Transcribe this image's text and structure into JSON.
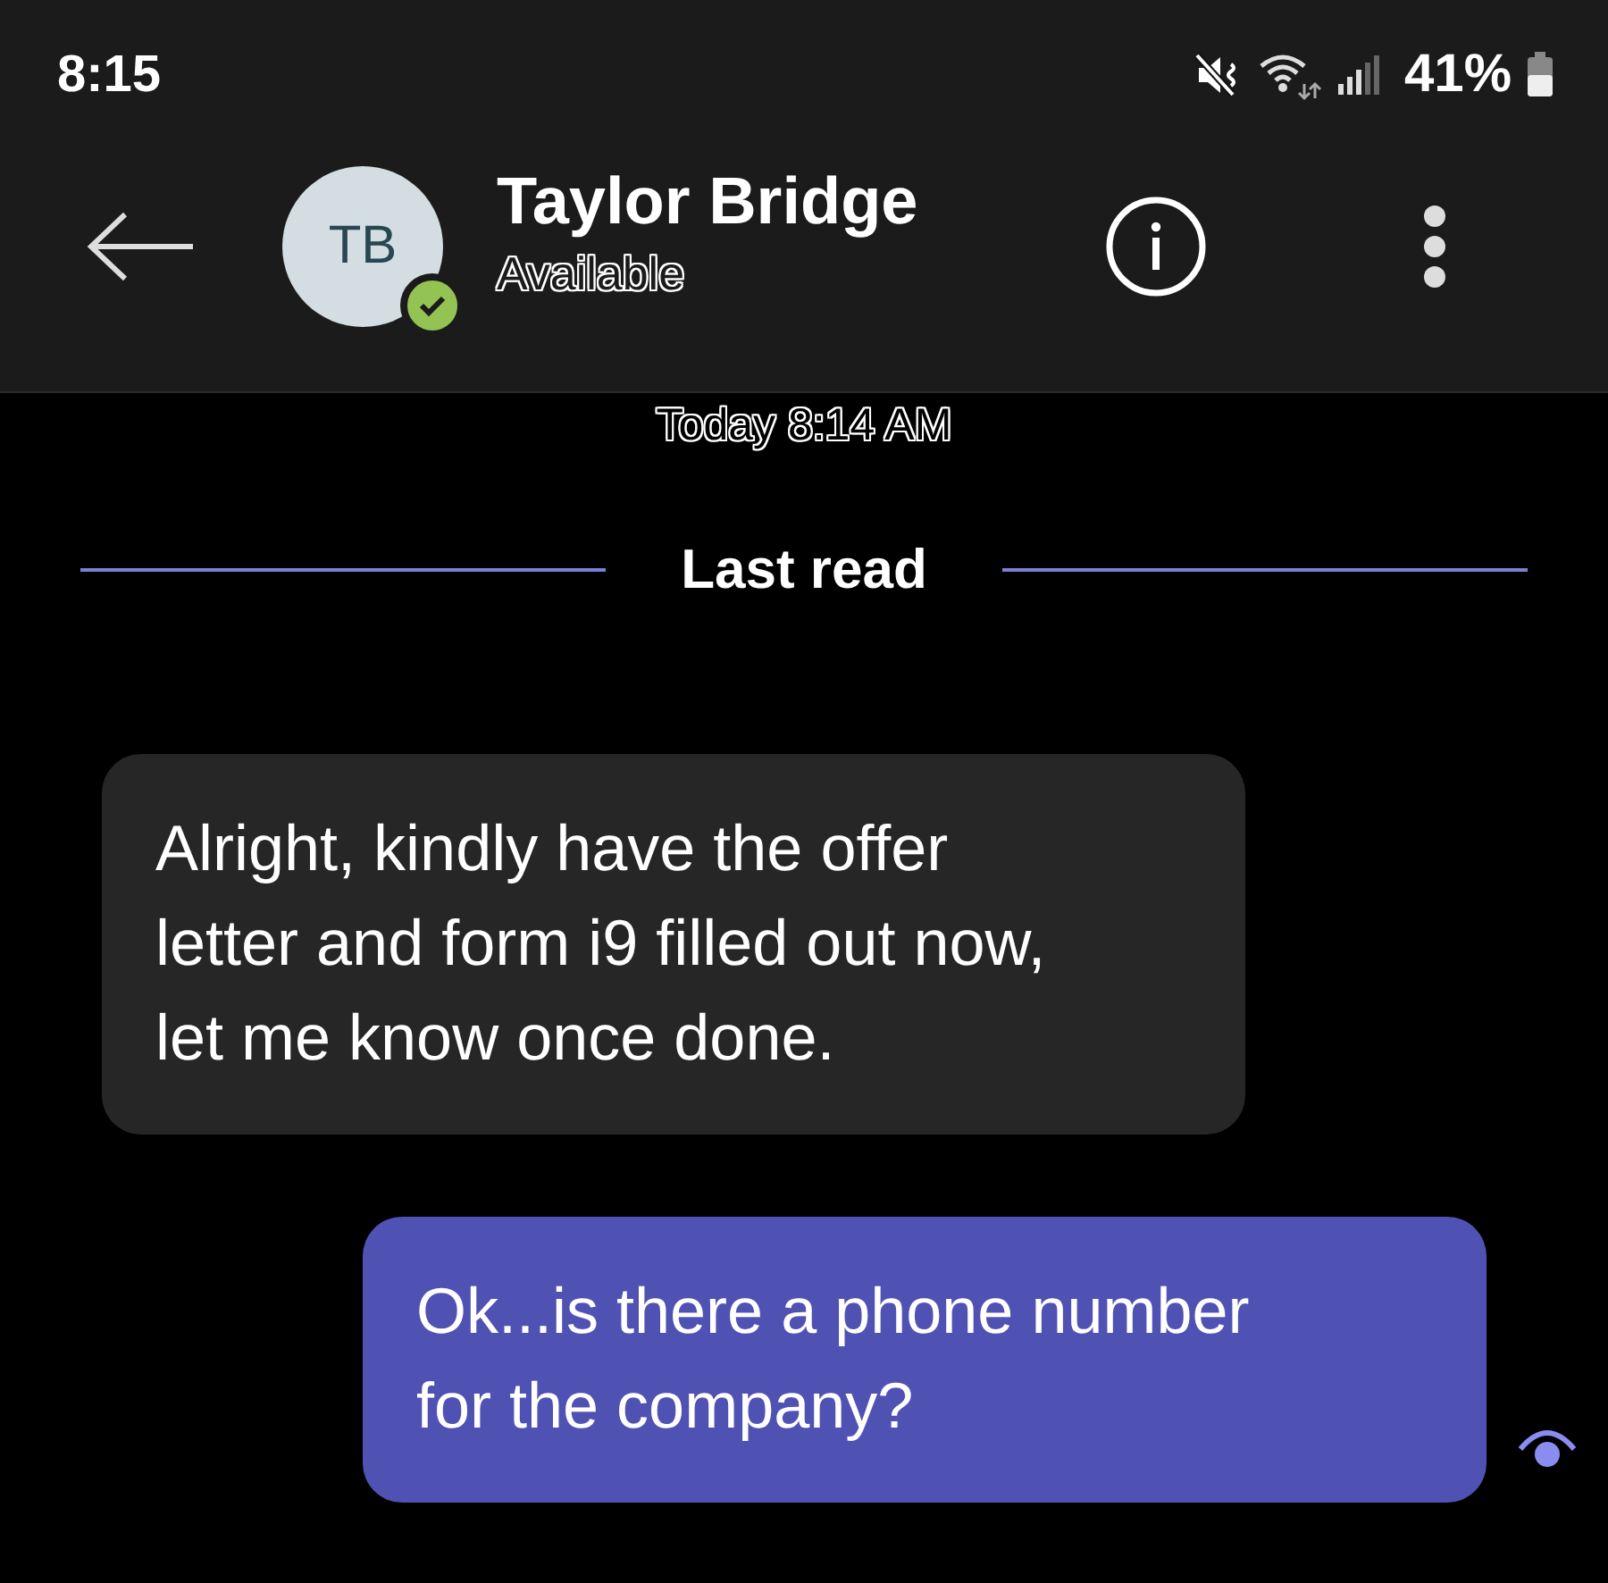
{
  "status_bar": {
    "time": "8:15",
    "battery_text": "41%"
  },
  "header": {
    "avatar_initials": "TB",
    "presence": {
      "kind": "check",
      "color": "#92c353"
    },
    "name": "Taylor Bridge",
    "status_text": "Available"
  },
  "timestamp": "Today 8:14 AM",
  "divider": {
    "label": "Last read"
  },
  "messages": [
    {
      "kind": "incoming",
      "text": "Alright, kindly have the offer letter and form i9 filled out now, let me know once done."
    },
    {
      "kind": "outgoing",
      "text": "Ok...is there a phone number for the company?",
      "seen": true
    }
  ]
}
